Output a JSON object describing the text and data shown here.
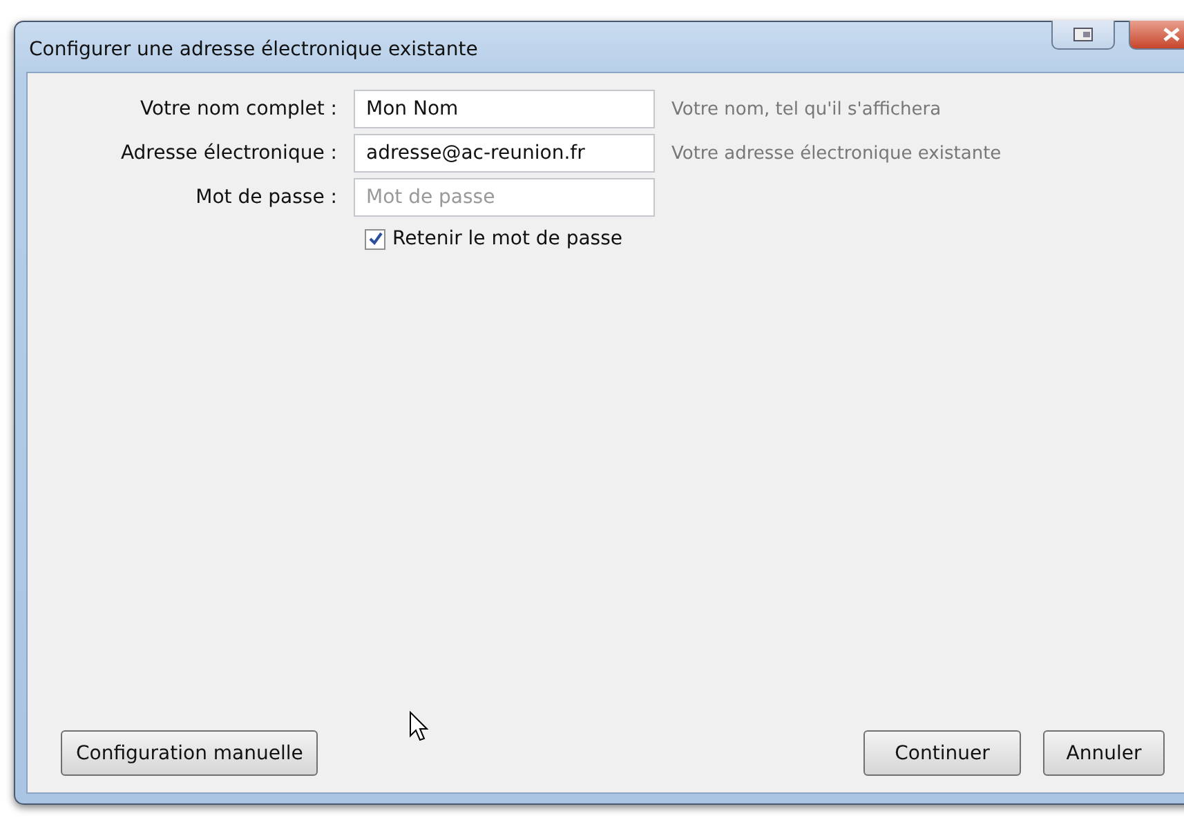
{
  "window": {
    "title": "Configurer une adresse électronique existante"
  },
  "fields": [
    {
      "label": "Votre nom complet :",
      "value": "Mon Nom",
      "hint": "Votre nom, tel qu'il s'affichera"
    },
    {
      "label": "Adresse électronique :",
      "value": "adresse@ac-reunion.fr",
      "hint": "Votre adresse électronique existante"
    },
    {
      "label": "Mot de passe :",
      "placeholder": "Mot de passe"
    }
  ],
  "remember": {
    "label": "Retenir le mot de passe",
    "checked": true
  },
  "buttons": {
    "left": [
      "Configuration manuelle"
    ],
    "right": [
      "Continuer",
      "Annuler"
    ]
  }
}
